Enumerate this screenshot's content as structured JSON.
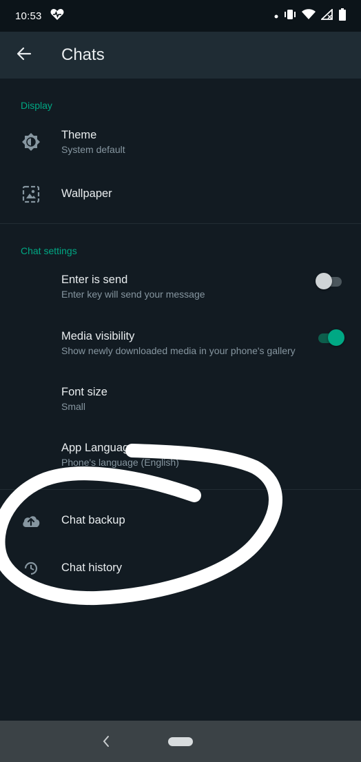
{
  "status_bar": {
    "time": "10:53",
    "left_icons": [
      "heart-icon"
    ],
    "right_icons": [
      "dot-icon",
      "vibrate-icon",
      "wifi-icon",
      "signal-icon",
      "battery-icon"
    ]
  },
  "app_bar": {
    "title": "Chats",
    "back_icon": "arrow-left-icon"
  },
  "display_section": {
    "header": "Display",
    "items": [
      {
        "title": "Theme",
        "subtitle": "System default",
        "icon": "brightness-icon"
      },
      {
        "title": "Wallpaper",
        "icon": "wallpaper-icon"
      }
    ]
  },
  "chat_settings_section": {
    "header": "Chat settings",
    "items": [
      {
        "title": "Enter is send",
        "subtitle": "Enter key will send your message",
        "toggle": false
      },
      {
        "title": "Media visibility",
        "subtitle": "Show newly downloaded media in your phone's gallery",
        "toggle": true
      },
      {
        "title": "Font size",
        "subtitle": "Small"
      },
      {
        "title": "App Language",
        "subtitle": "Phone's language (English)"
      }
    ]
  },
  "other_section": {
    "items": [
      {
        "title": "Chat backup",
        "icon": "cloud-upload-icon"
      },
      {
        "title": "Chat history",
        "icon": "history-icon"
      }
    ]
  },
  "colors": {
    "background": "#121b22",
    "app_bar": "#1f2c34",
    "accent": "#00a884",
    "secondary_text": "#8696a0",
    "annotation_stroke": "#ffffff"
  },
  "nav_bar": {
    "icons": [
      "nav-back-icon",
      "home-pill-icon"
    ]
  }
}
